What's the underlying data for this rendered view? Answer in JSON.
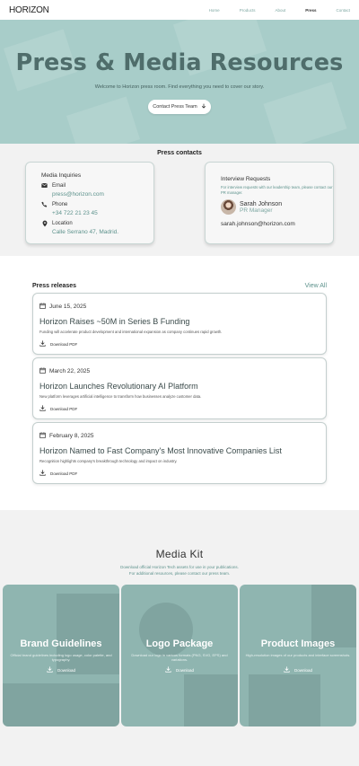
{
  "nav": {
    "logo": "HORIZON",
    "links": [
      "Home",
      "Products",
      "About",
      "Press",
      "Contact"
    ],
    "active": "Press"
  },
  "hero": {
    "title": "Press & Media Resources",
    "subtitle": "Welcome to Horizon press room. Find everything you need to cover our story.",
    "cta": "Contact Press Team",
    "cta_icon": "arrow-down-icon",
    "bg_color": "#a8cdc9",
    "title_color": "#4f6d6b"
  },
  "contacts": {
    "title": "Press contacts",
    "media": {
      "heading": "Media Inquiries",
      "email_label": "Email",
      "email": "press@horizon.com",
      "phone_label": "Phone",
      "phone": "+34 722 21 23 45",
      "location_label": "Location",
      "location": "Calle Serrano 47, Madrid."
    },
    "interview": {
      "heading": "Interview Requests",
      "description": "For interview requests with our leadership team, please contact our PR manager.",
      "name": "Sarah Johnson",
      "role": "PR Manager",
      "email": "sarah.johnson@horizon.com"
    }
  },
  "releases": {
    "title": "Press releases",
    "view_all": "View All",
    "items": [
      {
        "date": "June 15, 2025",
        "headline": "Horizon Raises ~50M in Series B Funding",
        "description": "Funding will accelerate product development and international expansion as company continues rapid growth.",
        "download": "Download PDF"
      },
      {
        "date": "March 22, 2025",
        "headline": "Horizon Launches Revolutionary AI Platform",
        "description": "New platform leverages artificial intelligence to transform how businesses analyze customer data.",
        "download": "Download PDF"
      },
      {
        "date": "February 8, 2025",
        "headline": "Horizon Named to Fast Company's Most Innovative Companies List",
        "description": "Recognition highlights company's breakthrough technology and impact on industry.",
        "download": "Download PDF"
      }
    ]
  },
  "media_kit": {
    "title": "Media Kit",
    "description_line1": "Download official Horizon Tech assets for use in your publications.",
    "description_line2": "For additional resources, please contact our press team.",
    "cards": [
      {
        "title": "Brand Guidelines",
        "text": "Official brand guidelines including logo usage, color palette, and typography.",
        "download": "Download"
      },
      {
        "title": "Logo Package",
        "text": "Download our logo in various formats (PNG, SVG, EPS) and variations.",
        "download": "Download"
      },
      {
        "title": "Product Images",
        "text": "High-resolution images of our products and interface screenshots.",
        "download": "Download"
      }
    ]
  },
  "colors": {
    "accent": "#5d928c",
    "light_accent": "#7fa8a3",
    "section_gray": "#f2f2f2"
  }
}
